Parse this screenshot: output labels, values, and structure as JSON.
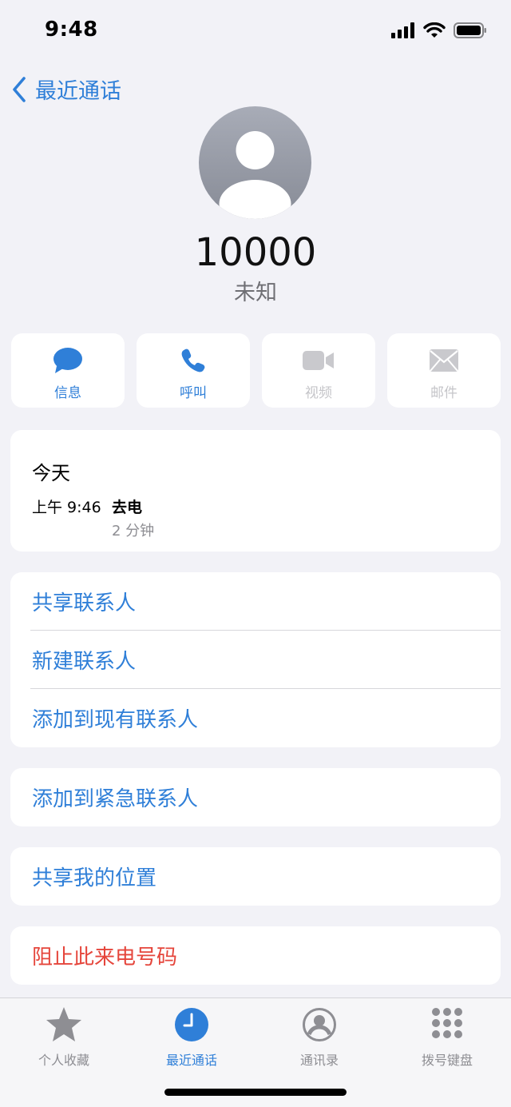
{
  "status_bar": {
    "time": "9:48"
  },
  "nav": {
    "back_label": "最近通话"
  },
  "contact": {
    "number": "10000",
    "label": "未知"
  },
  "actions": [
    {
      "label": "信息",
      "icon": "message-icon",
      "enabled": true
    },
    {
      "label": "呼叫",
      "icon": "phone-icon",
      "enabled": true
    },
    {
      "label": "视频",
      "icon": "video-icon",
      "enabled": false
    },
    {
      "label": "邮件",
      "icon": "mail-icon",
      "enabled": false
    }
  ],
  "call_history": {
    "day": "今天",
    "time": "上午 9:46",
    "type": "去电",
    "duration": "2 分钟"
  },
  "menu": {
    "share_contact": "共享联系人",
    "new_contact": "新建联系人",
    "add_existing": "添加到现有联系人",
    "add_emergency": "添加到紧急联系人",
    "share_location": "共享我的位置",
    "block_caller": "阻止此来电号码"
  },
  "tabs": [
    {
      "label": "个人收藏",
      "icon": "star-icon",
      "active": false
    },
    {
      "label": "最近通话",
      "icon": "clock-icon",
      "active": true
    },
    {
      "label": "通讯录",
      "icon": "contacts-icon",
      "active": false
    },
    {
      "label": "拨号键盘",
      "icon": "keypad-icon",
      "active": false
    }
  ],
  "colors": {
    "accent": "#2f7fd8",
    "danger": "#e5453b",
    "background": "#f2f2f7"
  }
}
